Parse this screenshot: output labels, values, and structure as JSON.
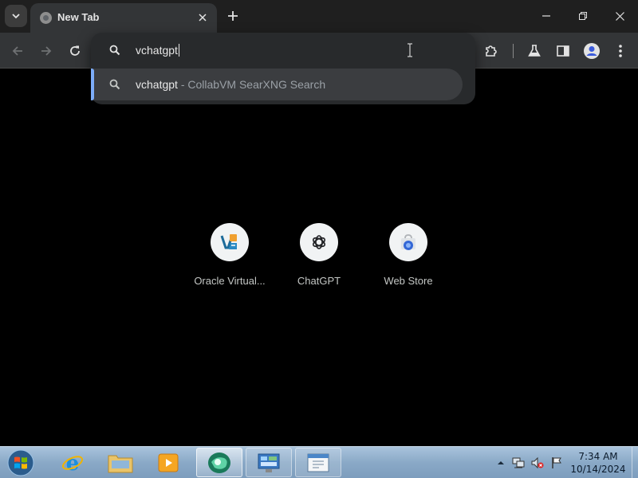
{
  "tab": {
    "title": "New Tab"
  },
  "omnibox": {
    "value": "vchatgpt"
  },
  "suggestion": {
    "query": "vchatgpt",
    "separator": " - ",
    "source": "CollabVM SearXNG Search"
  },
  "shortcuts": [
    {
      "label": "Oracle Virtual...",
      "icon": "virtualbox-icon"
    },
    {
      "label": "ChatGPT",
      "icon": "chatgpt-icon"
    },
    {
      "label": "Web Store",
      "icon": "web-store-icon"
    }
  ],
  "taskbar": {
    "items": [
      "internet-explorer",
      "file-explorer",
      "media-player",
      "chrome-window",
      "control-panel",
      "window-app"
    ]
  },
  "clock": {
    "time": "7:34 AM",
    "date": "10/14/2024"
  },
  "colors": {
    "accent": "#7cacf8",
    "background": "#000000",
    "toolbar": "#333537"
  }
}
